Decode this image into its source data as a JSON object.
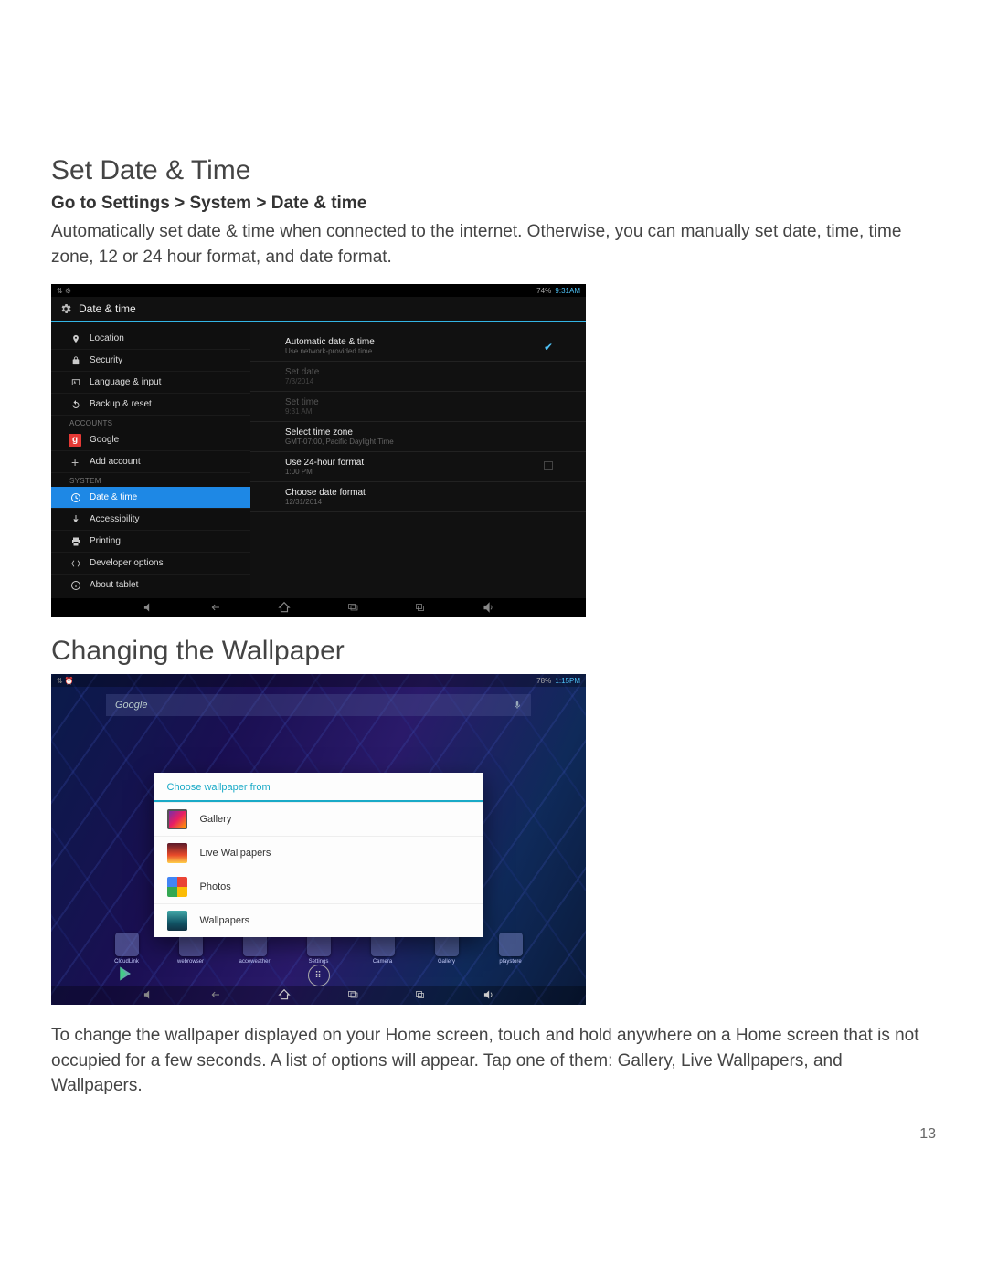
{
  "page_number": "13",
  "section1": {
    "heading": "Set Date & Time",
    "subhead": "Go to Settings > System > Date & time",
    "body": "Automatically set date & time when connected to the internet. Otherwise, you can manually set date, time, time zone, 12 or 24 hour format, and date format."
  },
  "shot1": {
    "status": {
      "left": "⇅  ⚙",
      "batt": "74%",
      "time": "9:31AM"
    },
    "header": "Date & time",
    "sidebar": {
      "items": [
        {
          "label": "Location",
          "icon": "location"
        },
        {
          "label": "Security",
          "icon": "lock"
        },
        {
          "label": "Language & input",
          "icon": "lang"
        },
        {
          "label": "Backup & reset",
          "icon": "reset"
        }
      ],
      "accounts_header": "ACCOUNTS",
      "accounts": [
        {
          "label": "Google",
          "icon": "google"
        },
        {
          "label": "Add account",
          "icon": "plus"
        }
      ],
      "system_header": "SYSTEM",
      "system": [
        {
          "label": "Date & time",
          "icon": "clock",
          "selected": true
        },
        {
          "label": "Accessibility",
          "icon": "access"
        },
        {
          "label": "Printing",
          "icon": "print"
        },
        {
          "label": "Developer options",
          "icon": "dev"
        },
        {
          "label": "About tablet",
          "icon": "info"
        }
      ]
    },
    "main": {
      "rows": [
        {
          "t": "Automatic date & time",
          "s": "Use network-provided time",
          "check": true
        },
        {
          "t": "Set date",
          "s": "7/3/2014",
          "disabled": true
        },
        {
          "t": "Set time",
          "s": "9:31 AM",
          "disabled": true
        },
        {
          "t": "Select time zone",
          "s": "GMT-07:00, Pacific Daylight Time"
        },
        {
          "t": "Use 24-hour format",
          "s": "1:00 PM",
          "box": true
        },
        {
          "t": "Choose date format",
          "s": "12/31/2014"
        }
      ]
    }
  },
  "section2": {
    "heading": "Changing the Wallpaper",
    "body": "To change the wallpaper displayed on your Home screen, touch and hold anywhere on a Home screen that is not occupied for a few seconds. A list of options will appear. Tap one of them: Gallery, Live Wallpapers, and Wallpapers."
  },
  "shot2": {
    "status": {
      "left": "⇅  ⏰",
      "batt": "78%",
      "time": "1:15PM"
    },
    "search": "Google",
    "dialog": {
      "title": "Choose wallpaper from",
      "rows": [
        {
          "label": "Gallery",
          "icon": "gal"
        },
        {
          "label": "Live Wallpapers",
          "icon": "live"
        },
        {
          "label": "Photos",
          "icon": "photos"
        },
        {
          "label": "Wallpapers",
          "icon": "wall"
        }
      ]
    },
    "apps": [
      "CloudLink",
      "webrowser",
      "acceweather",
      "Settings",
      "Camera",
      "Gallery",
      "playstore"
    ]
  }
}
